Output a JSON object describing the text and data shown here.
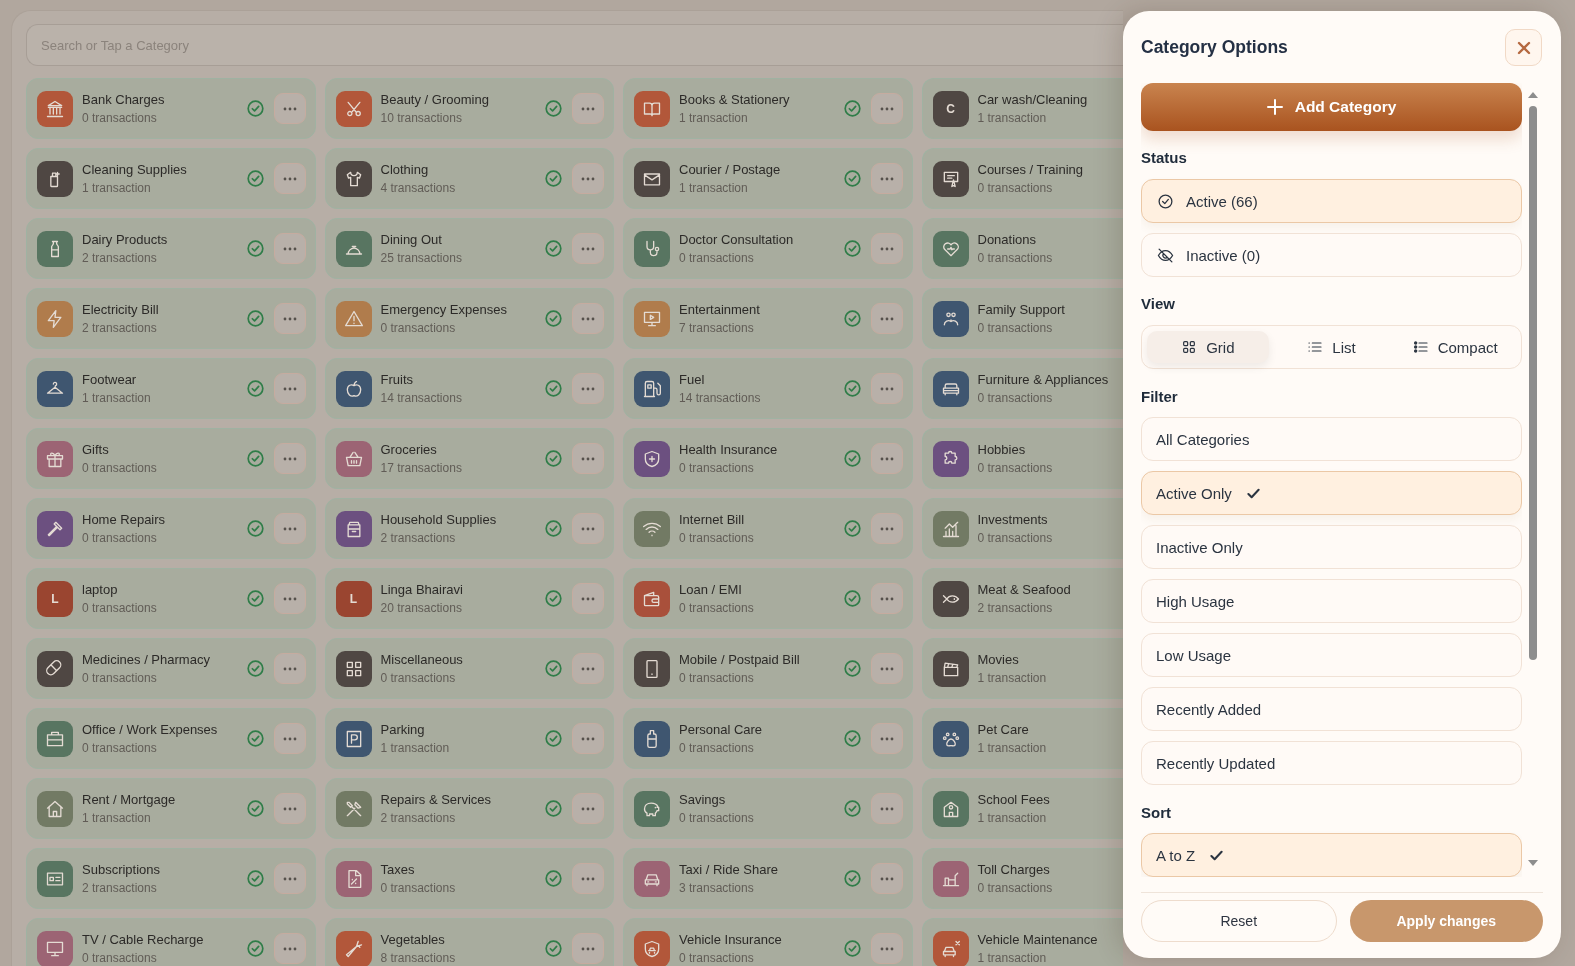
{
  "search": {
    "placeholder": "Search or Tap a Category"
  },
  "categories": [
    {
      "name": "Bank Charges",
      "count": "0 transactions",
      "active": true,
      "color": "#b2573a"
    },
    {
      "name": "Beauty / Grooming",
      "count": "10 transactions",
      "active": true,
      "color": "#b2573a"
    },
    {
      "name": "Books & Stationery",
      "count": "1 transaction",
      "active": true,
      "color": "#b2573a"
    },
    {
      "name": "Car wash/Cleaning",
      "count": "1 transaction",
      "color": "#4f4743",
      "letter": "C"
    },
    {
      "name": "Cleaning Supplies",
      "count": "1 transaction",
      "active": true,
      "color": "#4f4743"
    },
    {
      "name": "Clothing",
      "count": "4 transactions",
      "active": true,
      "color": "#4f4743"
    },
    {
      "name": "Courier / Postage",
      "count": "1 transaction",
      "active": true,
      "color": "#4f4743"
    },
    {
      "name": "Courses / Training",
      "count": "0 transactions",
      "color": "#4f4743"
    },
    {
      "name": "Dairy Products",
      "count": "2 transactions",
      "active": true,
      "color": "#587561"
    },
    {
      "name": "Dining Out",
      "count": "25 transactions",
      "active": true,
      "color": "#587561"
    },
    {
      "name": "Doctor Consultation",
      "count": "0 transactions",
      "active": true,
      "color": "#587561"
    },
    {
      "name": "Donations",
      "count": "0 transactions",
      "color": "#587561"
    },
    {
      "name": "Electricity Bill",
      "count": "2 transactions",
      "active": true,
      "color": "#b07c4c"
    },
    {
      "name": "Emergency Expenses",
      "count": "0 transactions",
      "active": true,
      "color": "#b07c4c"
    },
    {
      "name": "Entertainment",
      "count": "7 transactions",
      "active": true,
      "color": "#b07c4c"
    },
    {
      "name": "Family Support",
      "count": "0 transactions",
      "color": "#3f5670"
    },
    {
      "name": "Footwear",
      "count": "1 transaction",
      "active": true,
      "color": "#3f5670"
    },
    {
      "name": "Fruits",
      "count": "14 transactions",
      "active": true,
      "color": "#3f5670"
    },
    {
      "name": "Fuel",
      "count": "14 transactions",
      "active": true,
      "color": "#3f5670"
    },
    {
      "name": "Furniture & Appliances",
      "count": "0 transactions",
      "color": "#3f5670"
    },
    {
      "name": "Gifts",
      "count": "0 transactions",
      "active": true,
      "color": "#9c6474"
    },
    {
      "name": "Groceries",
      "count": "17 transactions",
      "active": true,
      "color": "#9c6474"
    },
    {
      "name": "Health Insurance",
      "count": "0 transactions",
      "active": true,
      "color": "#6c5080"
    },
    {
      "name": "Hobbies",
      "count": "0 transactions",
      "color": "#6c5080"
    },
    {
      "name": "Home Repairs",
      "count": "0 transactions",
      "active": true,
      "color": "#6c5080"
    },
    {
      "name": "Household Supplies",
      "count": "2 transactions",
      "active": true,
      "color": "#6c5080"
    },
    {
      "name": "Internet Bill",
      "count": "0 transactions",
      "active": true,
      "color": "#727a64"
    },
    {
      "name": "Investments",
      "count": "0 transactions",
      "color": "#727a64"
    },
    {
      "name": "laptop",
      "count": "0 transactions",
      "active": true,
      "color": "#9a4530",
      "letter": "L"
    },
    {
      "name": "Linga Bhairavi",
      "count": "20 transactions",
      "active": true,
      "color": "#9a4530",
      "letter": "L"
    },
    {
      "name": "Loan / EMI",
      "count": "0 transactions",
      "active": true,
      "color": "#a9503b"
    },
    {
      "name": "Meat & Seafood",
      "count": "2 transactions",
      "color": "#4f4743"
    },
    {
      "name": "Medicines / Pharmacy",
      "count": "0 transactions",
      "active": true,
      "color": "#4f4743"
    },
    {
      "name": "Miscellaneous",
      "count": "0 transactions",
      "active": true,
      "color": "#4f4743"
    },
    {
      "name": "Mobile / Postpaid Bill",
      "count": "0 transactions",
      "active": true,
      "color": "#4f4743"
    },
    {
      "name": "Movies",
      "count": "1 transaction",
      "color": "#4f4743"
    },
    {
      "name": "Office / Work Expenses",
      "count": "0 transactions",
      "active": true,
      "color": "#587561"
    },
    {
      "name": "Parking",
      "count": "1 transaction",
      "active": true,
      "color": "#3f5670"
    },
    {
      "name": "Personal Care",
      "count": "0 transactions",
      "active": true,
      "color": "#3f5670"
    },
    {
      "name": "Pet Care",
      "count": "1 transaction",
      "color": "#3f5670"
    },
    {
      "name": "Rent / Mortgage",
      "count": "1 transaction",
      "active": true,
      "color": "#727a64"
    },
    {
      "name": "Repairs & Services",
      "count": "2 transactions",
      "active": true,
      "color": "#727a64"
    },
    {
      "name": "Savings",
      "count": "0 transactions",
      "active": true,
      "color": "#587561"
    },
    {
      "name": "School Fees",
      "count": "1 transaction",
      "color": "#587561"
    },
    {
      "name": "Subscriptions",
      "count": "2 transactions",
      "active": true,
      "color": "#587561"
    },
    {
      "name": "Taxes",
      "count": "0 transactions",
      "active": true,
      "color": "#9c6474"
    },
    {
      "name": "Taxi / Ride Share",
      "count": "3 transactions",
      "active": true,
      "color": "#9c6474"
    },
    {
      "name": "Toll Charges",
      "count": "0 transactions",
      "color": "#9c6474"
    },
    {
      "name": "TV / Cable Recharge",
      "count": "0 transactions",
      "active": true,
      "color": "#9c6474"
    },
    {
      "name": "Vegetables",
      "count": "8 transactions",
      "active": true,
      "color": "#b2573a"
    },
    {
      "name": "Vehicle Insurance",
      "count": "0 transactions",
      "active": true,
      "color": "#b2573a"
    },
    {
      "name": "Vehicle Maintenance",
      "count": "1 transaction",
      "color": "#b2573a"
    }
  ],
  "panel": {
    "title": "Category Options",
    "add_button": "Add Category",
    "status": {
      "heading": "Status",
      "options": [
        {
          "label": "Active (66)",
          "selected": true
        },
        {
          "label": "Inactive (0)",
          "selected": false
        }
      ]
    },
    "view": {
      "heading": "View",
      "options": [
        {
          "label": "Grid",
          "selected": true
        },
        {
          "label": "List",
          "selected": false
        },
        {
          "label": "Compact",
          "selected": false
        }
      ]
    },
    "filter": {
      "heading": "Filter",
      "options": [
        {
          "label": "All Categories",
          "selected": false
        },
        {
          "label": "Active Only",
          "selected": true
        },
        {
          "label": "Inactive Only",
          "selected": false
        },
        {
          "label": "High Usage",
          "selected": false
        },
        {
          "label": "Low Usage",
          "selected": false
        },
        {
          "label": "Recently Added",
          "selected": false
        },
        {
          "label": "Recently Updated",
          "selected": false
        }
      ]
    },
    "sort": {
      "heading": "Sort",
      "options": [
        {
          "label": "A to Z",
          "selected": true
        }
      ]
    },
    "footer": {
      "reset_button": "Reset",
      "apply_button": "Apply changes"
    }
  }
}
